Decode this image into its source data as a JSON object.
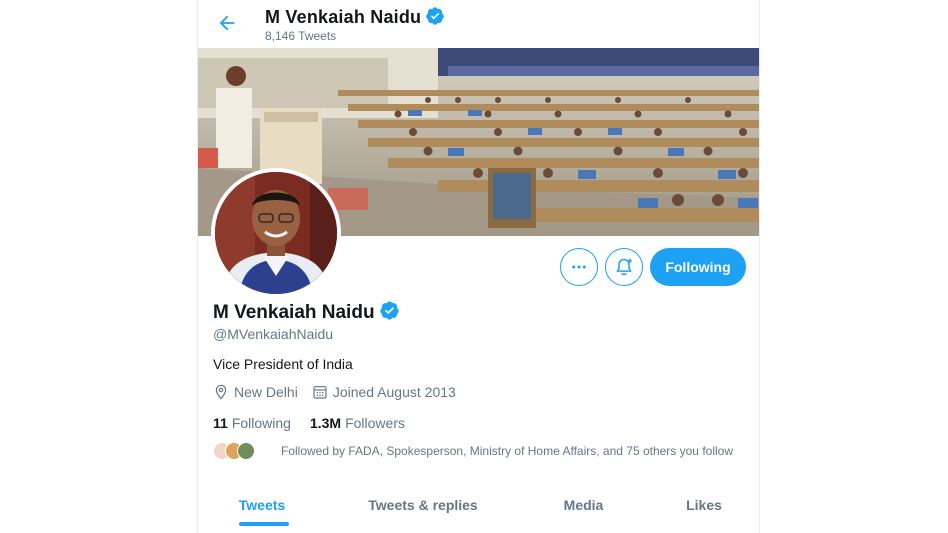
{
  "header": {
    "name": "M Venkaiah Naidu",
    "tweet_count": "8,146 Tweets"
  },
  "actions": {
    "following_label": "Following"
  },
  "profile": {
    "name": "M Venkaiah Naidu",
    "handle": "@MVenkaiahNaidu",
    "bio": "Vice President of India",
    "location": "New Delhi",
    "joined": "Joined August 2013",
    "following_count": "11",
    "following_label": "Following",
    "followers_count": "1.3M",
    "followers_label": "Followers",
    "followed_by": "Followed by FADA, Spokesperson, Ministry of Home Affairs, and 75 others you follow"
  },
  "tabs": [
    {
      "label": "Tweets",
      "active": true
    },
    {
      "label": "Tweets & replies",
      "active": false
    },
    {
      "label": "Media",
      "active": false
    },
    {
      "label": "Likes",
      "active": false
    }
  ],
  "icons": {
    "back": "arrow-left-icon",
    "verified": "verified-badge-icon",
    "more": "more-dots-icon",
    "bell": "notification-bell-icon",
    "location": "location-pin-icon",
    "calendar": "calendar-icon"
  },
  "colors": {
    "accent": "#1da1f2",
    "text": "#14171a",
    "secondary": "#657786"
  }
}
